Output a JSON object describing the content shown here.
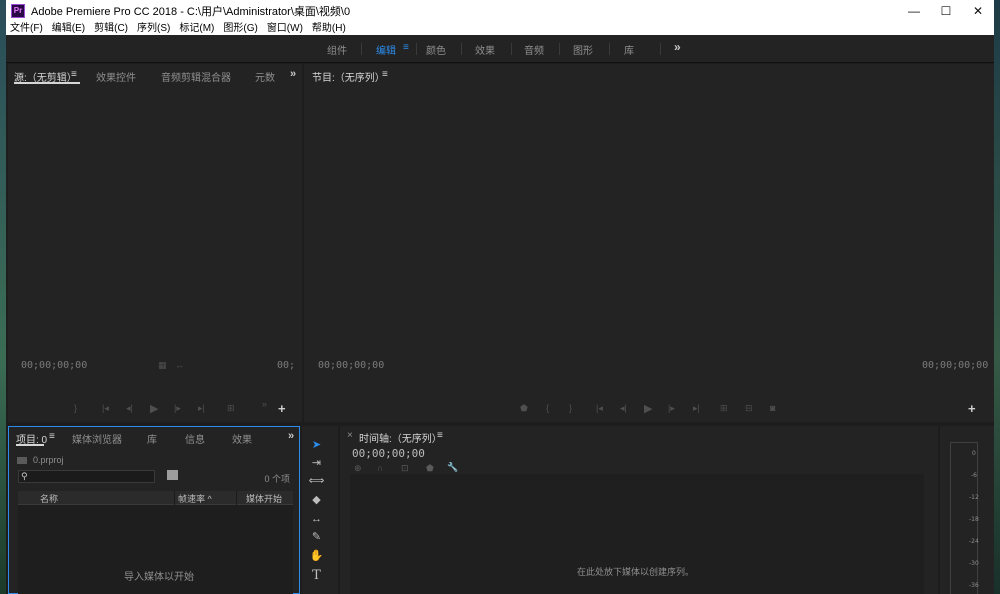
{
  "window": {
    "title": "Adobe Premiere Pro CC 2018 - C:\\用户\\Administrator\\桌面\\视频\\0",
    "app_icon": "Pr",
    "controls": {
      "minimize": "—",
      "maximize": "☐",
      "close": "✕"
    }
  },
  "menu": [
    "文件(F)",
    "编辑(E)",
    "剪辑(C)",
    "序列(S)",
    "标记(M)",
    "图形(G)",
    "窗口(W)",
    "帮助(H)"
  ],
  "workspaces": {
    "tabs": [
      "组件",
      "编辑",
      "颜色",
      "效果",
      "音频",
      "图形",
      "库"
    ],
    "active": "编辑",
    "menu_icon": "≡",
    "more": "»"
  },
  "source_panel": {
    "tabs": [
      "源:（无剪辑）",
      "效果控件",
      "音频剪辑混合器",
      "元数"
    ],
    "menu_icon": "≡",
    "more": "»",
    "timecode_left": "00;00;00;00",
    "timecode_right": "00;",
    "add": "+"
  },
  "program_panel": {
    "title": "节目:（无序列）",
    "menu_icon": "≡",
    "timecode_left": "00;00;00;00",
    "timecode_right": "00;00;00;00",
    "add": "+"
  },
  "project_panel": {
    "tabs": [
      "项目: 0",
      "媒体浏览器",
      "库",
      "信息",
      "效果"
    ],
    "menu_icon": "≡",
    "more": "»",
    "file": "0.prproj",
    "search_placeholder": "",
    "item_count": "0 个项",
    "columns": [
      "名称",
      "帧速率 ^",
      "媒体开始"
    ],
    "hint": "导入媒体以开始"
  },
  "timeline": {
    "close": "×",
    "title": "时间轴:（无序列）",
    "menu_icon": "≡",
    "timecode": "00;00;00;00",
    "hint": "在此处放下媒体以创建序列。"
  },
  "audio_meter": {
    "labels": [
      "0",
      "-6",
      "-12",
      "-18",
      "-24",
      "-30",
      "-36"
    ]
  },
  "colors": {
    "accent": "#2d8ceb",
    "panel_bg": "#232323",
    "text_dim": "#8f8f8f"
  }
}
